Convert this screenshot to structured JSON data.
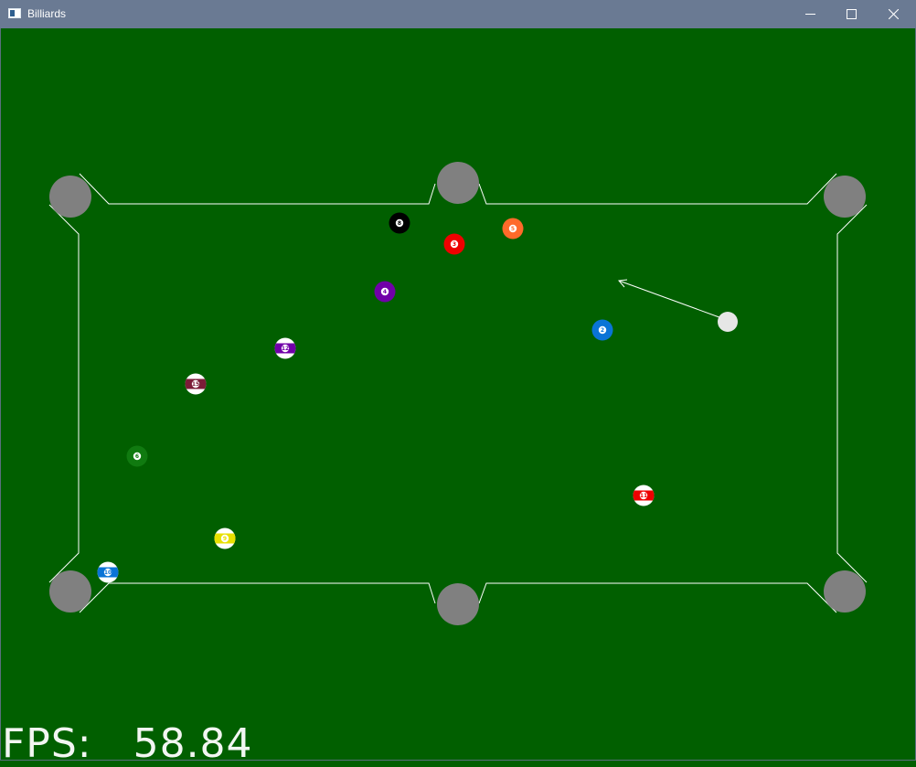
{
  "window": {
    "title": "Billiards",
    "icon": "app-window-icon",
    "controls": [
      "minimize-icon",
      "maximize-icon",
      "close-icon"
    ]
  },
  "hud": {
    "fps_label": "FPS:",
    "fps_value": "58.84"
  },
  "colors": {
    "felt": "#015f00",
    "cushion_line": "#ffffff",
    "pocket": "#808080",
    "titlebar": "#6a7a93",
    "cue_ball": "#e6e6e6"
  },
  "balls": [
    {
      "id": "ball-8",
      "number": "8",
      "color": "#000000",
      "striped": false
    },
    {
      "id": "ball-3",
      "number": "3",
      "color": "#ee0000",
      "striped": false
    },
    {
      "id": "ball-5",
      "number": "5",
      "color": "#ff6a2a",
      "striped": false
    },
    {
      "id": "ball-4",
      "number": "4",
      "color": "#7000a8",
      "striped": false
    },
    {
      "id": "ball-2",
      "number": "2",
      "color": "#0a74d6",
      "striped": false
    },
    {
      "id": "ball-12",
      "number": "12",
      "color": "#7000a8",
      "striped": true
    },
    {
      "id": "ball-15",
      "number": "15",
      "color": "#7b1c38",
      "striped": true
    },
    {
      "id": "ball-6",
      "number": "6",
      "color": "#107a10",
      "striped": false
    },
    {
      "id": "ball-11",
      "number": "11",
      "color": "#ee0000",
      "striped": true
    },
    {
      "id": "ball-9",
      "number": "9",
      "color": "#e8e000",
      "striped": true
    },
    {
      "id": "ball-10",
      "number": "10",
      "color": "#0a74d6",
      "striped": true
    }
  ]
}
